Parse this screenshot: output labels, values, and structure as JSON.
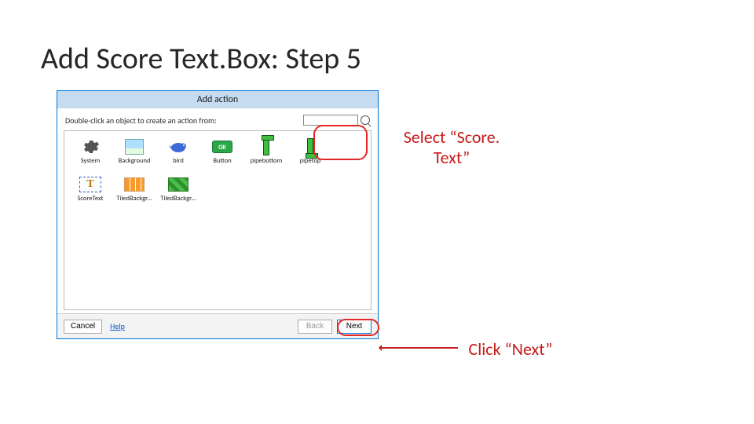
{
  "slide": {
    "title": "Add Score Text.Box: Step 5"
  },
  "dialog": {
    "title": "Add action",
    "instruction": "Double-click an object to create an action from:",
    "search_placeholder": "",
    "help": "Help",
    "buttons": {
      "cancel": "Cancel",
      "back": "Back",
      "next": "Next"
    }
  },
  "objects": [
    {
      "key": "system",
      "label": "System"
    },
    {
      "key": "background",
      "label": "Background"
    },
    {
      "key": "bird",
      "label": "bird"
    },
    {
      "key": "button",
      "label": "Button"
    },
    {
      "key": "pipebottom",
      "label": "pipebottom"
    },
    {
      "key": "pipetop",
      "label": "pipetop"
    },
    {
      "key": "scoretext",
      "label": "ScoreText"
    },
    {
      "key": "tiledbg1",
      "label": "TiledBackgr..."
    },
    {
      "key": "tiledbg2",
      "label": "TiledBackgr..."
    }
  ],
  "object_button_text": {
    "ok": "OK"
  },
  "annotations": {
    "select": "Select “Score. Text”",
    "click_next": "Click “Next”"
  }
}
